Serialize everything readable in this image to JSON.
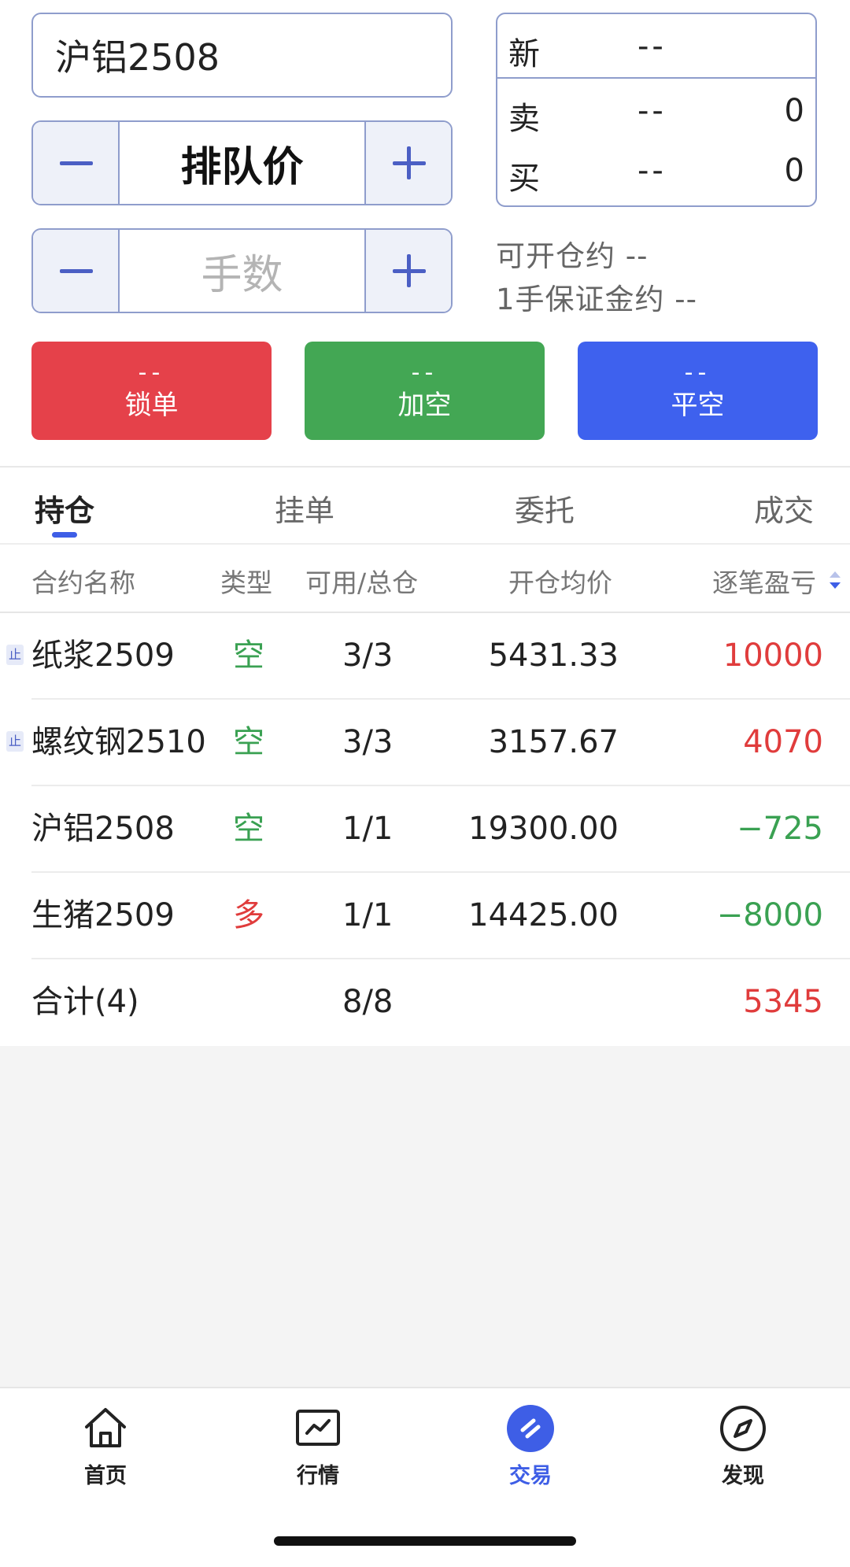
{
  "order_form": {
    "contract": "沪铝2508",
    "price_mode": "排队价",
    "lots_placeholder": "手数",
    "minus_symbol": "−",
    "plus_symbol": "+"
  },
  "quote": {
    "last": {
      "label": "新",
      "price": "--"
    },
    "ask": {
      "label": "卖",
      "price": "--",
      "volume": "0"
    },
    "bid": {
      "label": "买",
      "price": "--",
      "volume": "0"
    }
  },
  "account_info": {
    "open_available": "可开仓约 --",
    "margin_per_lot": "1手保证金约 --"
  },
  "actions": [
    {
      "top": "--",
      "label": "锁单",
      "color": "#e5414a"
    },
    {
      "top": "--",
      "label": "加空",
      "color": "#43a754"
    },
    {
      "top": "--",
      "label": "平空",
      "color": "#3e61ee"
    }
  ],
  "tabs": [
    "持仓",
    "挂单",
    "委托",
    "成交"
  ],
  "active_tab": "持仓",
  "table": {
    "headers": [
      "合约名称",
      "类型",
      "可用/总仓",
      "开仓均价",
      "逐笔盈亏"
    ],
    "rows": [
      {
        "stop": "止",
        "name": "纸浆2509",
        "type": "空",
        "qty": "3/3",
        "avg_price": "5431.33",
        "pnl": "10000"
      },
      {
        "stop": "止",
        "name": "螺纹钢2510",
        "type": "空",
        "qty": "3/3",
        "avg_price": "3157.67",
        "pnl": "4070"
      },
      {
        "stop": "",
        "name": "沪铝2508",
        "type": "空",
        "qty": "1/1",
        "avg_price": "19300.00",
        "pnl": "−725"
      },
      {
        "stop": "",
        "name": "生猪2509",
        "type": "多",
        "qty": "1/1",
        "avg_price": "14425.00",
        "pnl": "−8000"
      }
    ],
    "total": {
      "label": "合计(4)",
      "qty": "8/8",
      "pnl": "5345"
    }
  },
  "bottom_nav": [
    {
      "label": "首页",
      "icon": "home-icon"
    },
    {
      "label": "行情",
      "icon": "market-chart-icon"
    },
    {
      "label": "交易",
      "icon": "trade-icon",
      "active": true
    },
    {
      "label": "发现",
      "icon": "compass-icon"
    }
  ],
  "colors": {
    "accent": "#3e5ee6",
    "border": "#8f9dcc",
    "loss_green": "#3aa152",
    "profit_red": "#e03c3c"
  }
}
